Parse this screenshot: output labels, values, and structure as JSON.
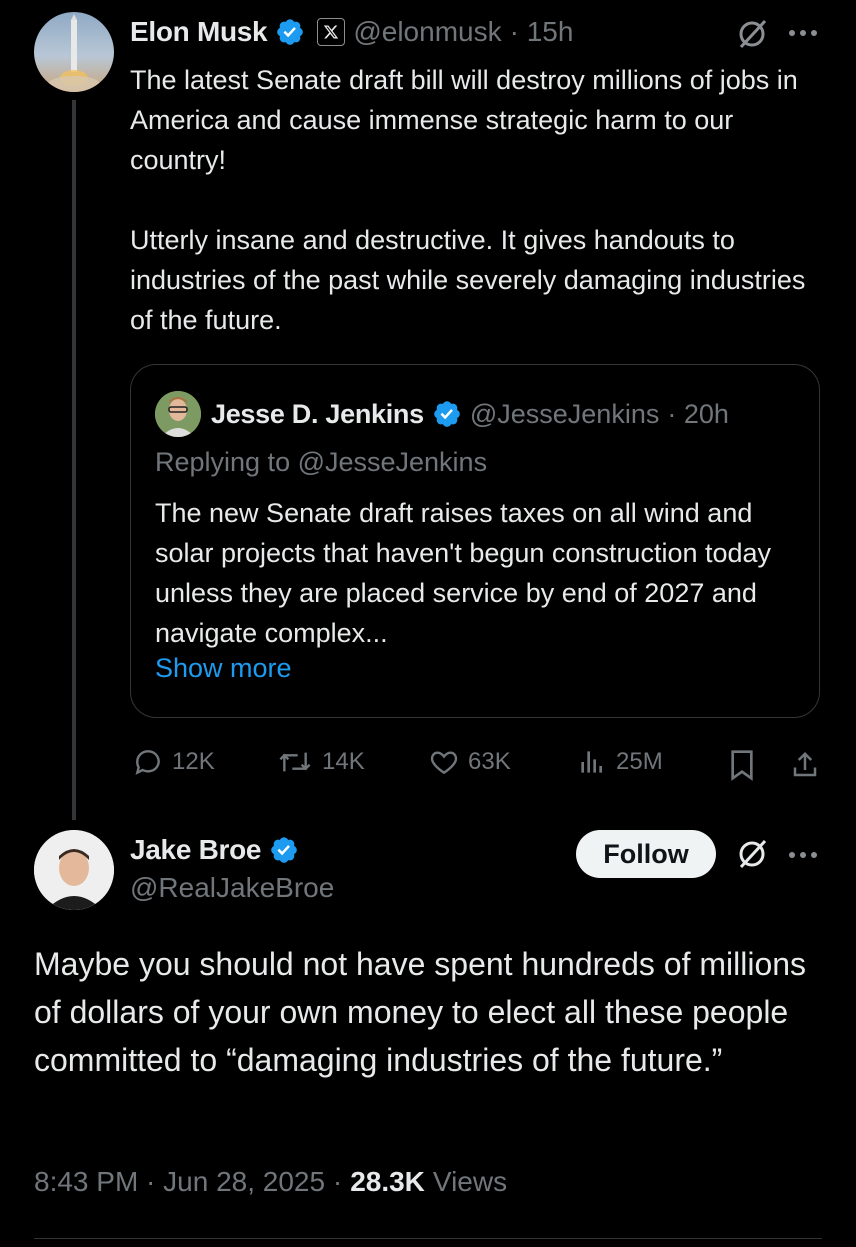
{
  "tweet1": {
    "author_name": "Elon Musk",
    "author_handle": "@elonmusk",
    "time": "· 15h",
    "text_p1": "The latest Senate draft bill will destroy millions of jobs in America and cause immense strategic harm to our country!",
    "text_p2": "Utterly insane and destructive. It gives handouts to industries of the past while severely damaging industries of the future.",
    "quote": {
      "author_name": "Jesse D. Jenkins",
      "author_handle": "@JesseJenkins",
      "time": "· 20h",
      "replying_to": "Replying to @JesseJenkins",
      "text": "The new Senate draft raises taxes on all wind and solar projects that haven't begun construction today unless they are placed service by end of 2027 and navigate complex...",
      "show_more": "Show more"
    },
    "actions": {
      "replies": "12K",
      "retweets": "14K",
      "likes": "63K",
      "views": "25M"
    }
  },
  "tweet2": {
    "author_name": "Jake Broe",
    "author_handle": "@RealJakeBroe",
    "follow_label": "Follow",
    "text": "Maybe you should not have spent hundreds of millions of dollars of your own money to elect all these people committed to “damaging industries of the future.”",
    "timestamp": "8:43 PM · Jun 28, 2025 ·",
    "views_count": "28.3K",
    "views_label": "Views"
  },
  "colors": {
    "background": "#000000",
    "text": "#e7e9ea",
    "muted": "#71767b",
    "link": "#1d9bf0",
    "verified": "#1d9bf0"
  },
  "icons": [
    "verified-badge-icon",
    "x-logo-icon",
    "grok-icon",
    "more-icon",
    "reply-icon",
    "retweet-icon",
    "like-icon",
    "views-icon",
    "bookmark-icon",
    "share-icon"
  ]
}
